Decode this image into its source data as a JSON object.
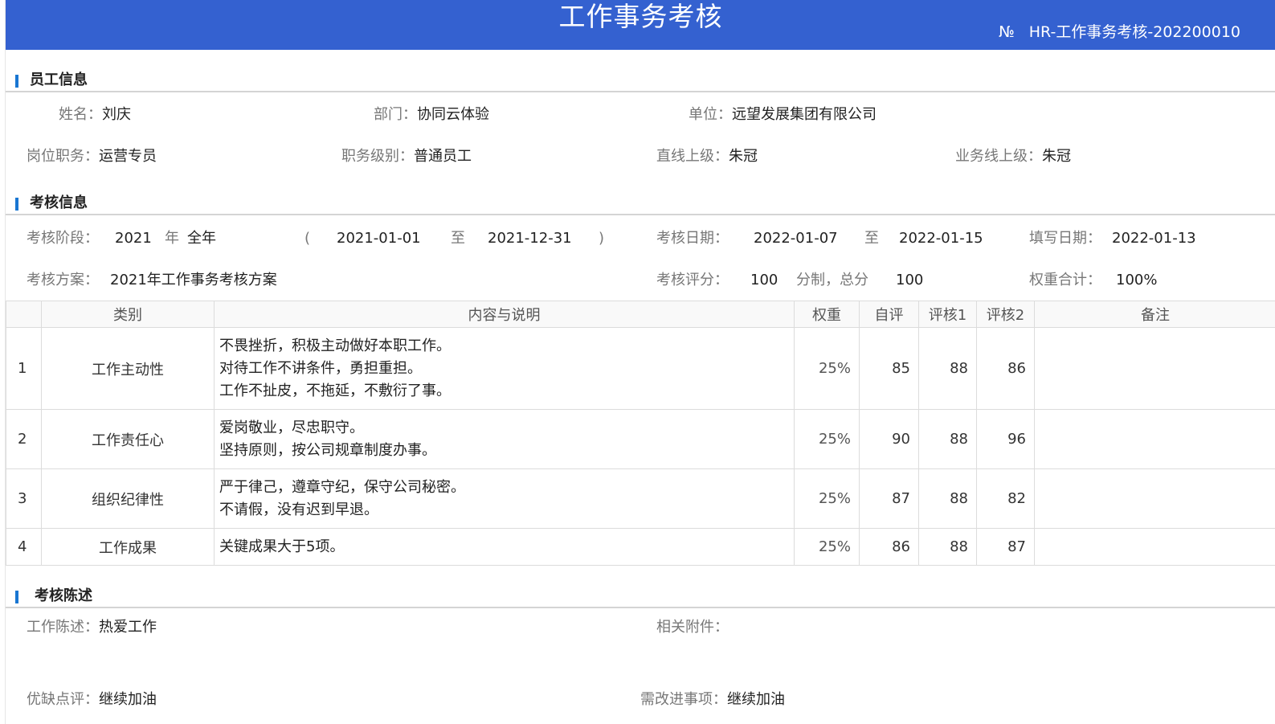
{
  "header": {
    "title": "工作事务考核",
    "doc_no_sign": "№",
    "doc_no": "HR-工作事务考核-202200010"
  },
  "employee_section": {
    "heading": "员工信息",
    "name_label": "姓名：",
    "name": "刘庆",
    "dept_label": "部门：",
    "dept": "协同云体验",
    "unit_label": "单位：",
    "unit": "远望发展集团有限公司",
    "position_label": "岗位职务：",
    "position": "运营专员",
    "level_label": "职务级别：",
    "level": "普通员工",
    "direct_sup_label": "直线上级：",
    "direct_sup": "朱冠",
    "biz_sup_label": "业务线上级：",
    "biz_sup": "朱冠"
  },
  "assessment_section": {
    "heading": "考核信息",
    "period_label": "考核阶段：",
    "period_year": "2021",
    "period_year_unit": "年",
    "period_scope": "全年",
    "paren_open": "(",
    "period_start": "2021-01-01",
    "to": "至",
    "period_end": "2021-12-31",
    "paren_close": ")",
    "date_label": "考核日期：",
    "date_start": "2022-01-07",
    "date_end": "2022-01-15",
    "fill_label": "填写日期：",
    "fill_date": "2022-01-13",
    "plan_label": "考核方案：",
    "plan": "2021年工作事务考核方案",
    "score_label": "考核评分：",
    "score_system": "100",
    "score_system_unit": "分制，总分",
    "score_total": "100",
    "weight_total_label": "权重合计：",
    "weight_total": "100%"
  },
  "table": {
    "headers": [
      "",
      "类别",
      "内容与说明",
      "权重",
      "自评",
      "评核1",
      "评核2",
      "备注"
    ],
    "rows": [
      {
        "idx": "1",
        "category": "工作主动性",
        "lines": [
          "不畏挫折，积极主动做好本职工作。",
          "对待工作不讲条件，勇担重担。",
          "工作不扯皮，不拖延，不敷衍了事。"
        ],
        "weight": "25%",
        "self": "85",
        "review1": "88",
        "review2": "86",
        "note": ""
      },
      {
        "idx": "2",
        "category": "工作责任心",
        "lines": [
          "爱岗敬业，尽忠职守。",
          "坚持原则，按公司规章制度办事。"
        ],
        "weight": "25%",
        "self": "90",
        "review1": "88",
        "review2": "96",
        "note": ""
      },
      {
        "idx": "3",
        "category": "组织纪律性",
        "lines": [
          "严于律己，遵章守纪，保守公司秘密。",
          "不请假，没有迟到早退。"
        ],
        "weight": "25%",
        "self": "87",
        "review1": "88",
        "review2": "82",
        "note": ""
      },
      {
        "idx": "4",
        "category": "工作成果",
        "lines": [
          "关键成果大于5项。"
        ],
        "weight": "25%",
        "self": "86",
        "review1": "88",
        "review2": "87",
        "note": ""
      }
    ]
  },
  "statement_section": {
    "heading": "考核陈述",
    "work_label": "工作陈述：",
    "work": "热爱工作",
    "attach_label": "相关附件：",
    "attach": "",
    "merit_label": "优缺点评：",
    "merit": "继续加油",
    "improve_label": "需改进事项：",
    "improve": "继续加油"
  },
  "colors": {
    "header_bg": "#3461d0",
    "accent": "#1976d2"
  }
}
